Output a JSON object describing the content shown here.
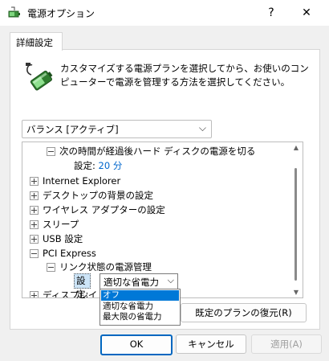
{
  "window": {
    "title": "電源オプション",
    "help_label": "?",
    "close_label": "✕"
  },
  "tab": {
    "label": "詳細設定"
  },
  "description": "カスタマイズする電源プランを選択してから、お使いのコンピューターで電源を管理する方法を選択してください。",
  "plan_combo": {
    "value": "バランス [アクティブ]"
  },
  "tree": {
    "hdd_label": "次の時間が経過後ハード ディスクの電源を切る",
    "hdd_setting_label": "設定:",
    "hdd_setting_value": "20 分",
    "items": [
      {
        "label": "Internet Explorer"
      },
      {
        "label": "デスクトップの背景の設定"
      },
      {
        "label": "ワイヤレス アダプターの設定"
      },
      {
        "label": "スリープ"
      },
      {
        "label": "USB 設定"
      }
    ],
    "pci_label": "PCI Express",
    "link_state_label": "リンク状態の電源管理",
    "link_setting_label": "設定:",
    "link_setting_value": "適切な省電力",
    "display_label": "ディスプレイ"
  },
  "dropdown_options": [
    "オフ",
    "適切な省電力",
    "最大限の省電力"
  ],
  "buttons": {
    "restore": "既定のプランの復元(R)",
    "ok": "OK",
    "cancel": "キャンセル",
    "apply": "適用(A)"
  },
  "colors": {
    "accent": "#0078d7",
    "value_link": "#0066cc"
  }
}
